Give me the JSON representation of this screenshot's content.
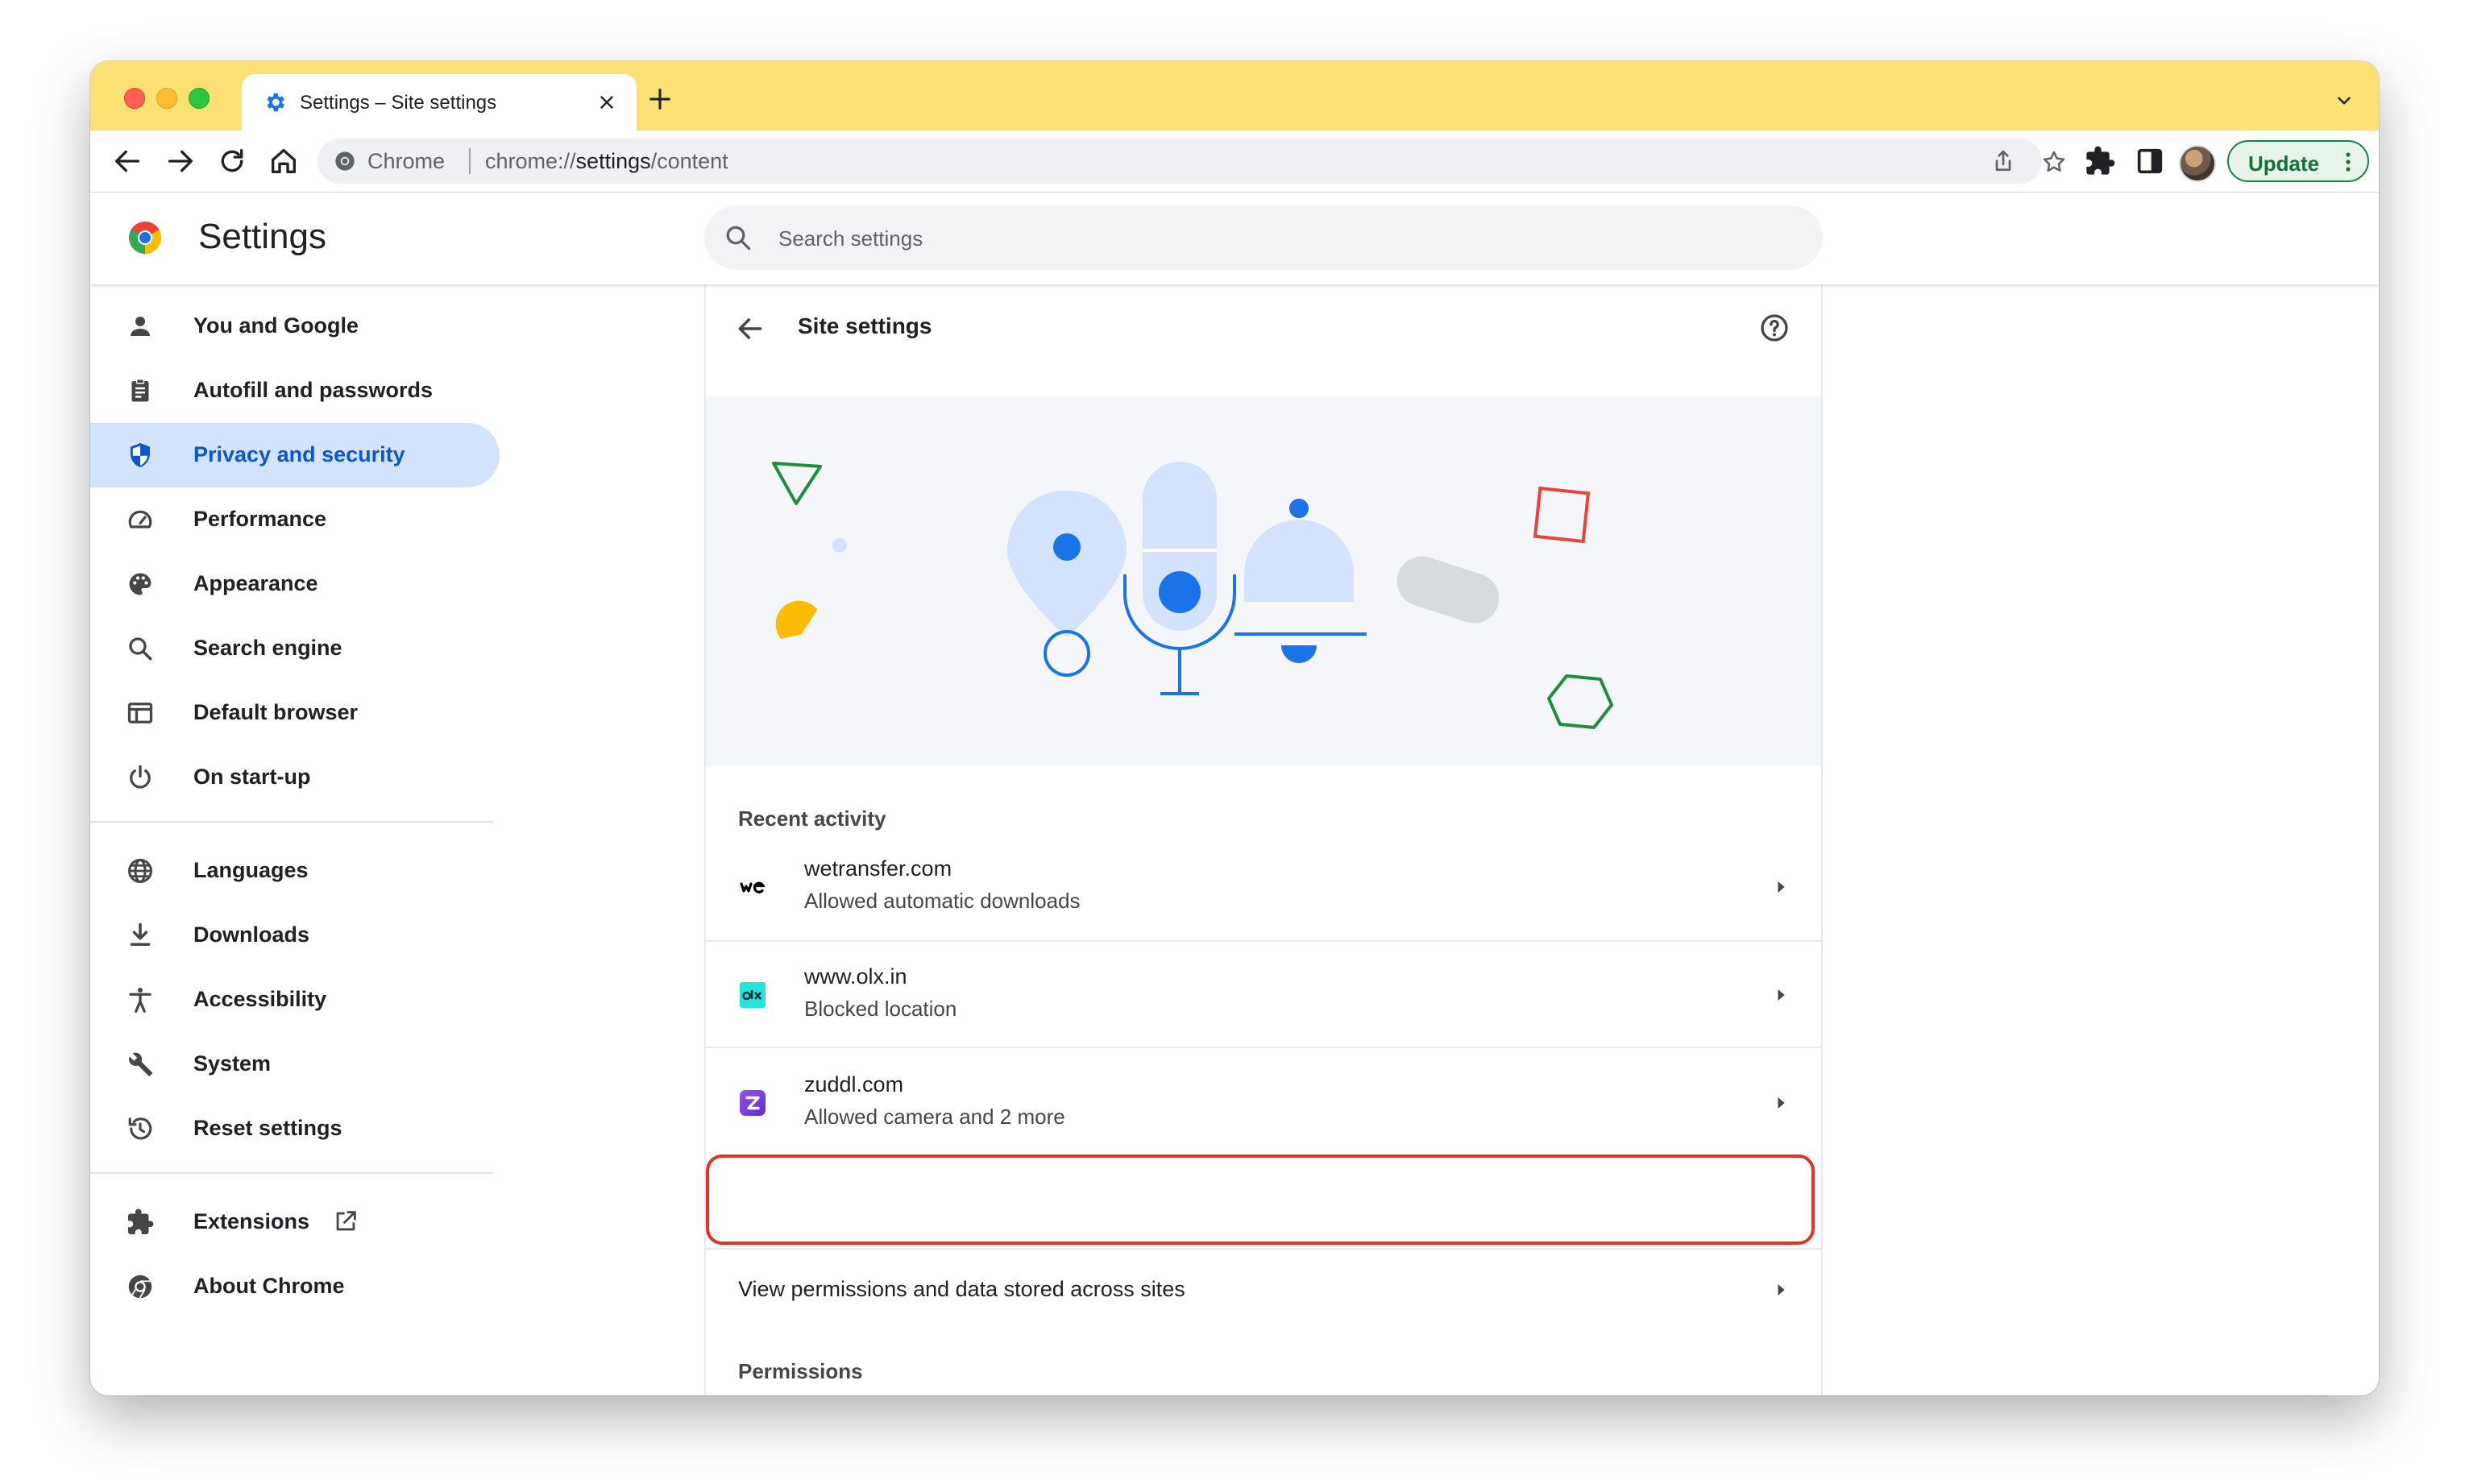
{
  "browser": {
    "tab_title": "Settings – Site settings",
    "omnibox_chip": "Chrome",
    "url_scheme": "chrome://",
    "url_host": "settings",
    "url_path": "/content",
    "update_label": "Update"
  },
  "settings": {
    "title": "Settings",
    "search_placeholder": "Search settings"
  },
  "sidebar": {
    "items": [
      {
        "label": "You and Google",
        "icon": "person-icon"
      },
      {
        "label": "Autofill and passwords",
        "icon": "clipboard-icon"
      },
      {
        "label": "Privacy and security",
        "icon": "shield-icon",
        "selected": true
      },
      {
        "label": "Performance",
        "icon": "speedometer-icon"
      },
      {
        "label": "Appearance",
        "icon": "palette-icon"
      },
      {
        "label": "Search engine",
        "icon": "search-icon"
      },
      {
        "label": "Default browser",
        "icon": "browser-window-icon"
      },
      {
        "label": "On start-up",
        "icon": "power-icon"
      },
      {
        "label": "Languages",
        "icon": "globe-icon"
      },
      {
        "label": "Downloads",
        "icon": "download-icon"
      },
      {
        "label": "Accessibility",
        "icon": "accessibility-icon"
      },
      {
        "label": "System",
        "icon": "wrench-icon"
      },
      {
        "label": "Reset settings",
        "icon": "history-icon"
      },
      {
        "label": "Extensions",
        "icon": "puzzle-icon"
      },
      {
        "label": "About Chrome",
        "icon": "chrome-logo-icon"
      }
    ]
  },
  "main": {
    "page_title": "Site settings",
    "recent_activity_label": "Recent activity",
    "recent": [
      {
        "site": "wetransfer.com",
        "desc": "Allowed automatic downloads",
        "favicon": "wetransfer-favicon"
      },
      {
        "site": "www.olx.in",
        "desc": "Blocked location",
        "favicon": "olx-favicon"
      },
      {
        "site": "zuddl.com",
        "desc": "Allowed camera and 2 more",
        "favicon": "zuddl-favicon",
        "highlighted": true
      }
    ],
    "view_permissions_label": "View permissions and data stored across sites",
    "permissions_label": "Permissions"
  },
  "colors": {
    "tabstrip": "#fde073",
    "accent": "#0b57d0",
    "selected_nav_bg": "#d3e3fd",
    "highlight_border": "#e3312a",
    "update_green": "#188038"
  }
}
